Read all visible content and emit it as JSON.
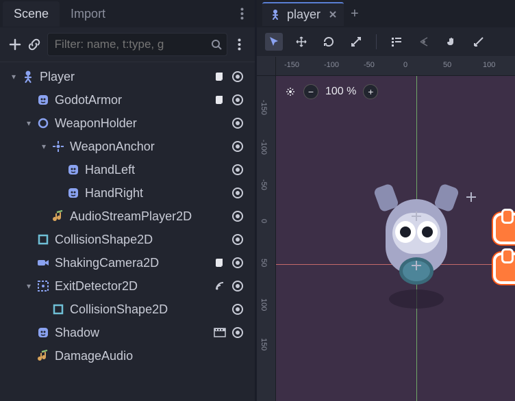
{
  "sceneDock": {
    "tabs": [
      {
        "label": "Scene",
        "active": true
      },
      {
        "label": "Import",
        "active": false
      }
    ],
    "filterPlaceholder": "Filter: name, t:type, g",
    "tree": [
      {
        "label": "Player",
        "depth": 0,
        "expander": "▾",
        "iconType": "character",
        "badges": [
          "script",
          "visible"
        ]
      },
      {
        "label": "GodotArmor",
        "depth": 1,
        "expander": "",
        "iconType": "sprite",
        "badges": [
          "script",
          "visible"
        ]
      },
      {
        "label": "WeaponHolder",
        "depth": 1,
        "expander": "▾",
        "iconType": "node2d",
        "badges": [
          "visible"
        ]
      },
      {
        "label": "WeaponAnchor",
        "depth": 2,
        "expander": "▾",
        "iconType": "remote",
        "badges": [
          "visible"
        ]
      },
      {
        "label": "HandLeft",
        "depth": 3,
        "expander": "",
        "iconType": "sprite",
        "badges": [
          "visible"
        ]
      },
      {
        "label": "HandRight",
        "depth": 3,
        "expander": "",
        "iconType": "sprite",
        "badges": [
          "visible"
        ]
      },
      {
        "label": "AudioStreamPlayer2D",
        "depth": 2,
        "expander": "",
        "iconType": "audio",
        "badges": [
          "visible"
        ]
      },
      {
        "label": "CollisionShape2D",
        "depth": 1,
        "expander": "",
        "iconType": "collision",
        "badges": [
          "visible"
        ]
      },
      {
        "label": "ShakingCamera2D",
        "depth": 1,
        "expander": "",
        "iconType": "camera",
        "badges": [
          "script",
          "visible"
        ]
      },
      {
        "label": "ExitDetector2D",
        "depth": 1,
        "expander": "▾",
        "iconType": "area",
        "badges": [
          "signal",
          "visible"
        ]
      },
      {
        "label": "CollisionShape2D",
        "depth": 2,
        "expander": "",
        "iconType": "collision",
        "badges": [
          "visible"
        ]
      },
      {
        "label": "Shadow",
        "depth": 1,
        "expander": "",
        "iconType": "sprite",
        "badges": [
          "anim",
          "visible"
        ]
      },
      {
        "label": "DamageAudio",
        "depth": 1,
        "expander": "",
        "iconType": "audio",
        "badges": []
      }
    ]
  },
  "editor": {
    "tabLabel": "player",
    "zoomLabel": "100 %",
    "rulerTop": [
      "-150",
      "-100",
      "-50",
      "0",
      "50",
      "100"
    ],
    "rulerLeft": [
      "-150",
      "-100",
      "-50",
      "0",
      "50",
      "100",
      "150"
    ]
  },
  "iconColors": {
    "blue": "#8aa2f0",
    "cyan": "#6fbfd6",
    "green": "#8ec979",
    "orange": "#d9a45a",
    "red": "#d47a7a"
  }
}
